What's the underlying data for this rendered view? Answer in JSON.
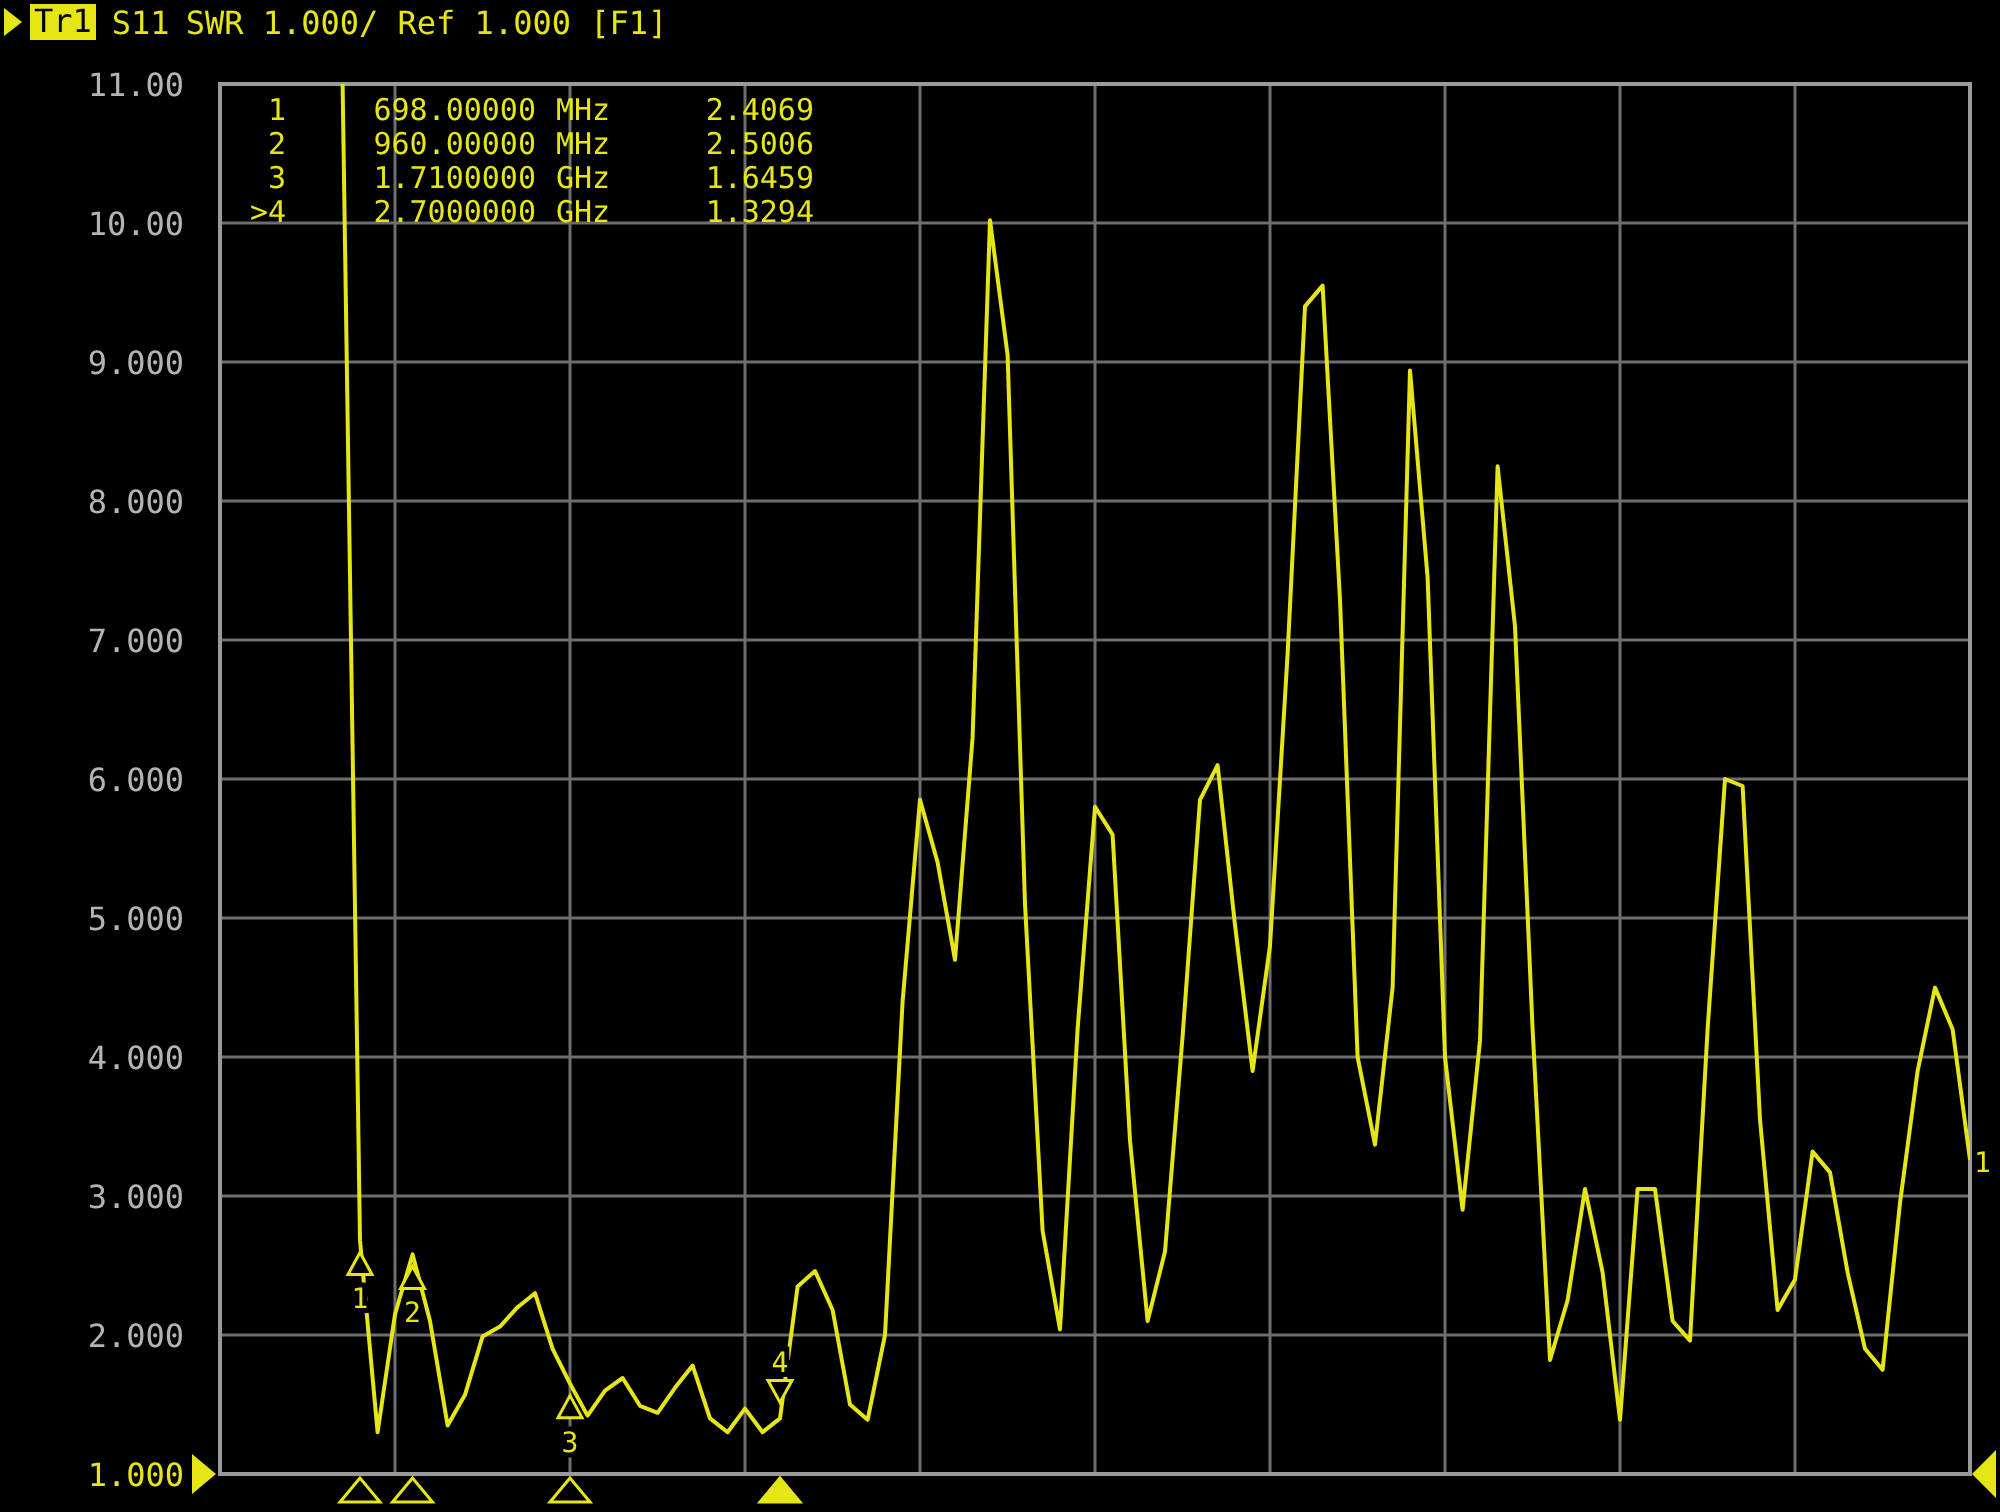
{
  "header": {
    "trace_label": "Tr1",
    "text": "SWR 1.000/ Ref 1.000 [F1]"
  },
  "marker_table": [
    {
      "row_label": "1",
      "frequency": "698.00000",
      "unit": "MHz",
      "value": "2.4069"
    },
    {
      "row_label": "2",
      "frequency": "960.00000",
      "unit": "MHz",
      "value": "2.5006"
    },
    {
      "row_label": "3",
      "frequency": "1.7100000",
      "unit": "GHz",
      "value": "1.6459"
    },
    {
      "row_label": ">4",
      "frequency": "2.7000000",
      "unit": "GHz",
      "value": "1.3294"
    }
  ],
  "chart_data": {
    "type": "line",
    "grid": true,
    "ylim": [
      1,
      11
    ],
    "yticks": [
      {
        "value": 11,
        "label": "11.00"
      },
      {
        "value": 10,
        "label": "10.00"
      },
      {
        "value": 9,
        "label": "9.000"
      },
      {
        "value": 8,
        "label": "8.000"
      },
      {
        "value": 7,
        "label": "7.000"
      },
      {
        "value": 6,
        "label": "6.000"
      },
      {
        "value": 5,
        "label": "5.000"
      },
      {
        "value": 4,
        "label": "4.000"
      },
      {
        "value": 3,
        "label": "3.000"
      },
      {
        "value": 2,
        "label": "2.000"
      },
      {
        "value": 1,
        "label": "1.000"
      }
    ],
    "categories": [
      null,
      null,
      null,
      null,
      null,
      null,
      null,
      null,
      null,
      null,
      null,
      null,
      null,
      null,
      null,
      null,
      null,
      null,
      null,
      null,
      null,
      null,
      null,
      null,
      null,
      null,
      null,
      null,
      null,
      null,
      null,
      null,
      null,
      null,
      null,
      null,
      null,
      null,
      null,
      null,
      null,
      null,
      null,
      null,
      null,
      null,
      null,
      null,
      null,
      null,
      null,
      null,
      null,
      null,
      null,
      null,
      null,
      null,
      null,
      null,
      null,
      null,
      null,
      null,
      null,
      null,
      null,
      null,
      null,
      null,
      null,
      null,
      null,
      null,
      null,
      null,
      null,
      null,
      null,
      null,
      null,
      null,
      null,
      null,
      null,
      null,
      null,
      null,
      null,
      null,
      null,
      null,
      null,
      null,
      null,
      null,
      null,
      null,
      null,
      null,
      null
    ],
    "series": [
      {
        "name": "S11",
        "color": "#e6e617",
        "values": [
          null,
          null,
          null,
          null,
          null,
          null,
          null,
          11.0,
          2.68,
          1.3,
          2.15,
          2.58,
          2.1,
          1.35,
          1.57,
          1.99,
          2.06,
          2.2,
          2.3,
          1.9,
          1.65,
          1.42,
          1.6,
          1.69,
          1.49,
          1.44,
          1.62,
          1.78,
          1.4,
          1.3,
          1.47,
          1.3,
          1.4,
          2.35,
          2.46,
          2.18,
          1.5,
          1.39,
          2.0,
          4.4,
          5.85,
          5.4,
          4.7,
          6.3,
          10.02,
          9.05,
          5.1,
          2.75,
          2.04,
          4.2,
          5.8,
          5.6,
          3.4,
          2.1,
          2.6,
          4.15,
          5.85,
          6.1,
          4.95,
          3.9,
          4.8,
          6.9,
          9.4,
          9.55,
          7.29,
          4.0,
          3.37,
          4.5,
          8.94,
          7.45,
          4.0,
          2.9,
          4.12,
          8.25,
          7.1,
          4.2,
          1.82,
          2.25,
          3.05,
          2.45,
          1.39,
          3.05,
          3.05,
          2.1,
          1.96,
          4.2,
          6.0,
          5.95,
          3.55,
          2.18,
          2.4,
          3.32,
          3.17,
          2.45,
          1.9,
          1.75,
          2.95,
          3.9,
          4.5,
          4.2,
          3.26
        ]
      }
    ]
  },
  "trace_markers": [
    {
      "label": "1",
      "selected": false
    },
    {
      "label": "2",
      "selected": false
    },
    {
      "label": "3",
      "selected": false
    },
    {
      "label": "4",
      "selected": true
    }
  ],
  "trace_end_label": "1"
}
